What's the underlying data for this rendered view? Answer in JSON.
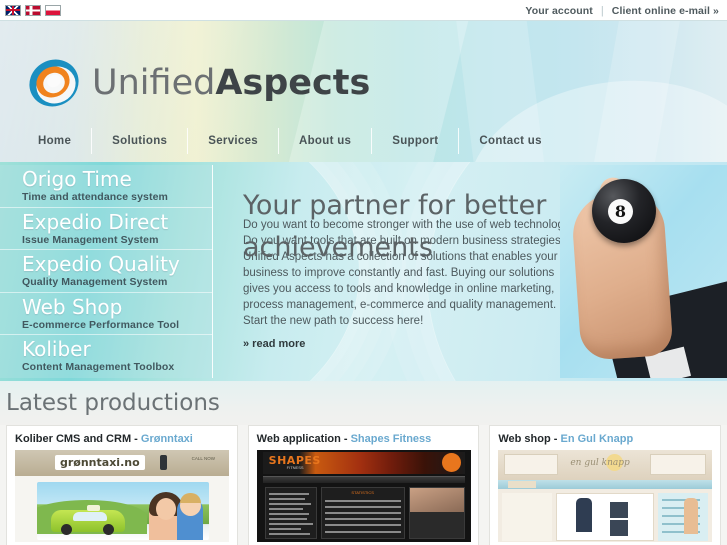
{
  "topbar": {
    "flags": [
      {
        "name": "flag-uk",
        "label": "English"
      },
      {
        "name": "flag-norway",
        "label": "Norsk"
      },
      {
        "name": "flag-poland",
        "label": "Polski"
      }
    ],
    "account_link": "Your account",
    "separator": "|",
    "email_link": "Client online e-mail »"
  },
  "brand": {
    "name_light": "Unified",
    "name_bold": "Aspects",
    "logo_icon": "swirl-logo-icon"
  },
  "nav": {
    "items": [
      {
        "label": "Home"
      },
      {
        "label": "Solutions"
      },
      {
        "label": "Services"
      },
      {
        "label": "About us"
      },
      {
        "label": "Support"
      },
      {
        "label": "Contact us"
      }
    ]
  },
  "products": [
    {
      "title": "Origo Time",
      "subtitle": "Time and attendance system"
    },
    {
      "title": "Expedio Direct",
      "subtitle": "Issue Management System"
    },
    {
      "title": "Expedio Quality",
      "subtitle": "Quality Management System"
    },
    {
      "title": "Web Shop",
      "subtitle": "E-commerce Performance Tool"
    },
    {
      "title": "Koliber",
      "subtitle": "Content Management Toolbox"
    }
  ],
  "hero": {
    "heading": "Your partner for better achievements",
    "body": "Do you want to become stronger with the use of web technology? Do you want tools that are built on modern business strategies? Unified Aspects has a collection of solutions that enables your business to improve constantly and fast. Buying our solutions gives you access to tools and knowledge in online marketing, process management, e-commerce and quality management. Start the new path to success here!",
    "read_more": "» read more",
    "image": {
      "name": "hand-holding-eight-ball",
      "ball_number": "8"
    }
  },
  "latest": {
    "heading": "Latest productions",
    "cards": [
      {
        "type": "Koliber CMS and CRM",
        "separator": " - ",
        "customer": "Grønntaxi",
        "thumb_name": "gronntaxi-site-thumbnail",
        "thumb_logo": "grønntaxi.no",
        "thumb_cta": "CALL NOW"
      },
      {
        "type": "Web application",
        "separator": " - ",
        "customer": "Shapes Fitness",
        "thumb_name": "shapes-fitness-app-thumbnail",
        "thumb_logo": "SHAPES",
        "thumb_sub": "FITNESS"
      },
      {
        "type": "Web shop",
        "separator": " - ",
        "customer": "En Gul Knapp",
        "thumb_name": "en-gul-knapp-shop-thumbnail",
        "thumb_logo": "en gul knapp"
      }
    ]
  },
  "colors": {
    "link_blue": "#6aa9cf",
    "text_dark": "#23282b",
    "header_green": "#d8ead2",
    "hero_teal": "#9fe0d8"
  }
}
